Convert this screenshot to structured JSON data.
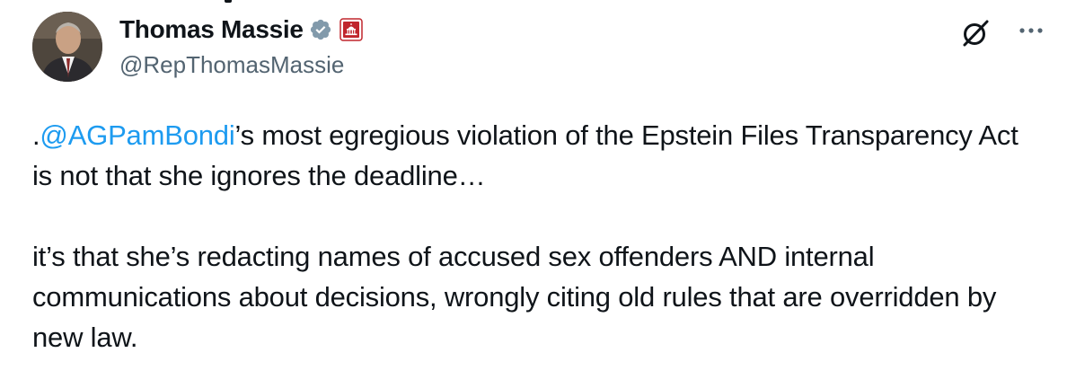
{
  "author": {
    "display_name": "Thomas Massie",
    "handle": "@RepThomasMassie",
    "verified_icon": "verified-badge-icon",
    "affiliation_icon": "us-capitol-icon",
    "colors": {
      "verified_badge": "#829aab",
      "affiliation_badge": "#c0262d"
    }
  },
  "actions": {
    "grok_icon": "grok-icon",
    "more_icon": "more-dots-icon"
  },
  "tweet": {
    "paragraph1_prefix": ".",
    "mention": "@AGPamBondi",
    "paragraph1_rest": "’s most egregious violation of the Epstein Files Transparency Act is not that she ignores the deadline…",
    "paragraph2": "it’s that she’s redacting names of accused sex offenders AND internal communications about decisions, wrongly citing old rules that are overridden by new law."
  },
  "colors": {
    "text": "#0f1419",
    "secondary": "#536471",
    "link": "#1d9bf0"
  }
}
